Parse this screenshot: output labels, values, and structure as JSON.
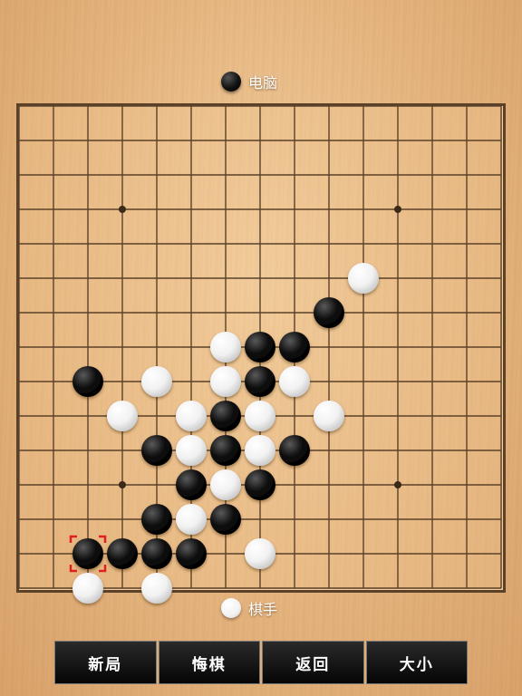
{
  "players": {
    "top": {
      "label": "电脑",
      "stone": "black"
    },
    "bottom": {
      "label": "棋手",
      "stone": "white"
    }
  },
  "board": {
    "size": 15,
    "star_points": [
      [
        3,
        3
      ],
      [
        11,
        3
      ],
      [
        3,
        11
      ],
      [
        11,
        11
      ]
    ],
    "black_stones": [
      [
        9,
        6
      ],
      [
        7,
        7
      ],
      [
        8,
        7
      ],
      [
        2,
        8
      ],
      [
        7,
        8
      ],
      [
        6,
        9
      ],
      [
        4,
        10
      ],
      [
        6,
        10
      ],
      [
        8,
        10
      ],
      [
        5,
        11
      ],
      [
        7,
        11
      ],
      [
        4,
        12
      ],
      [
        6,
        12
      ],
      [
        2,
        13
      ],
      [
        3,
        13
      ],
      [
        4,
        13
      ],
      [
        5,
        13
      ]
    ],
    "white_stones": [
      [
        10,
        5
      ],
      [
        6,
        7
      ],
      [
        4,
        8
      ],
      [
        6,
        8
      ],
      [
        8,
        8
      ],
      [
        3,
        9
      ],
      [
        5,
        9
      ],
      [
        7,
        9
      ],
      [
        9,
        9
      ],
      [
        5,
        10
      ],
      [
        7,
        10
      ],
      [
        6,
        11
      ],
      [
        5,
        12
      ],
      [
        7,
        13
      ],
      [
        2,
        14
      ],
      [
        4,
        14
      ]
    ],
    "last_move": [
      2,
      13
    ],
    "colors": {
      "line": "#5b4128",
      "highlight": "#e02020"
    }
  },
  "menu": {
    "new_game": "新局",
    "undo": "悔棋",
    "back": "返回",
    "size": "大小"
  }
}
